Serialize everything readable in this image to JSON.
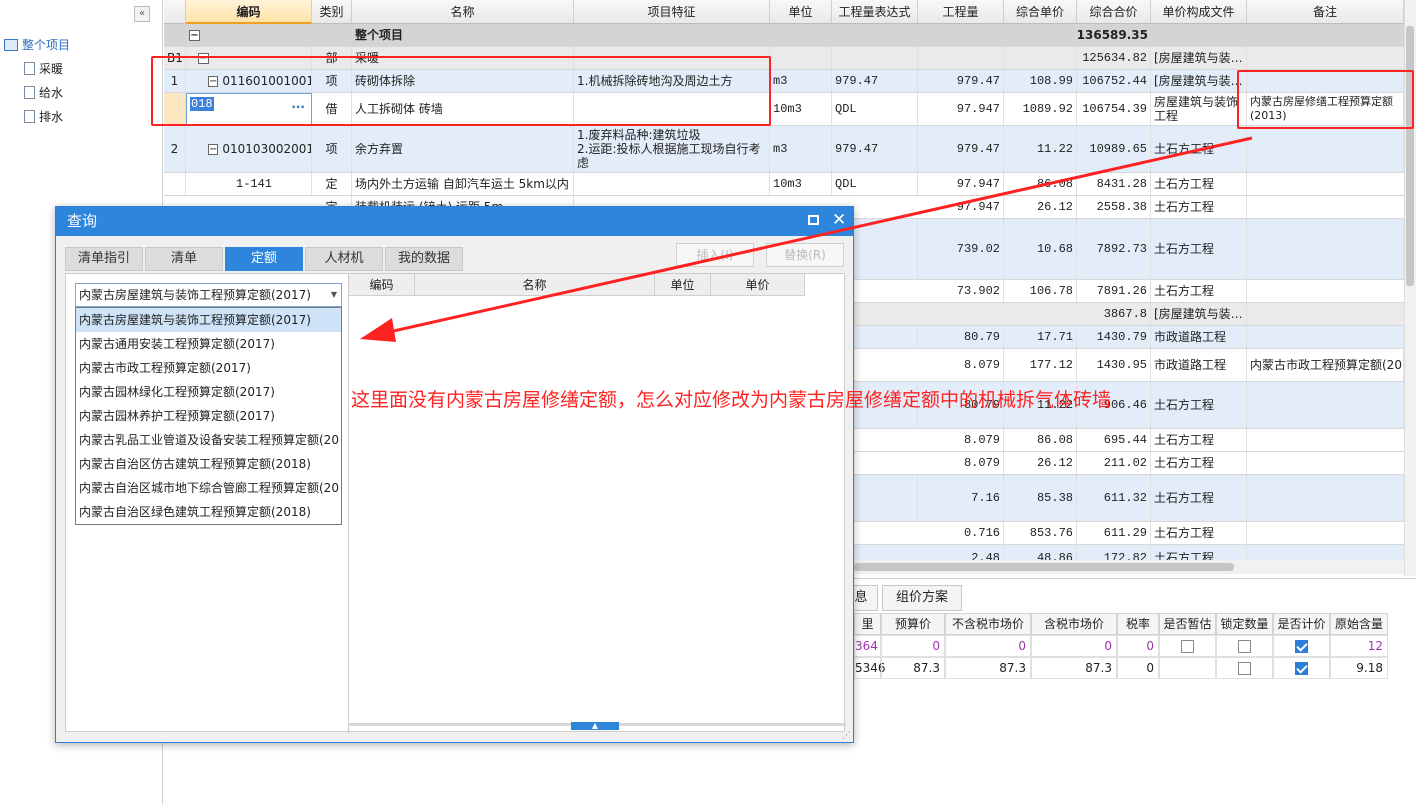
{
  "tree": {
    "collapse": "«",
    "root": "整个项目",
    "children": [
      "采暖",
      "给水",
      "排水"
    ]
  },
  "grid": {
    "headers": [
      "编码",
      "类别",
      "名称",
      "项目特征",
      "单位",
      "工程量表达式",
      "工程量",
      "综合单价",
      "综合合价",
      "单价构成文件",
      "备注"
    ],
    "rows": {
      "total": {
        "name": "整个项目",
        "total": "136589.35"
      },
      "b1": {
        "seq": "B1",
        "type": "部",
        "name": "采暖",
        "total": "125634.82",
        "file": "[房屋建筑与装…"
      },
      "r1": {
        "seq": "1",
        "code": "011601001001",
        "type": "项",
        "name": "砖砌体拆除",
        "feature": "1.机械拆除砖地沟及周边土方",
        "unit": "m3",
        "expr": "979.47",
        "qty": "979.47",
        "price": "108.99",
        "total": "106752.44",
        "file": "[房屋建筑与装…"
      },
      "r1s": {
        "code": "018",
        "type": "借",
        "name": "人工拆砌体 砖墙",
        "unit": "10m3",
        "expr": "QDL",
        "qty": "97.947",
        "price": "1089.92",
        "total": "106754.39",
        "file": "房屋建筑与装饰工程",
        "note": "内蒙古房屋修缮工程预算定额(2013)"
      },
      "r2": {
        "seq": "2",
        "code": "010103002001",
        "type": "项",
        "name": "余方弃置",
        "feature": "1.废弃料品种:建筑垃圾\n2.运距:投标人根据施工现场自行考虑",
        "unit": "m3",
        "expr": "979.47",
        "qty": "979.47",
        "price": "11.22",
        "total": "10989.65",
        "file": "土石方工程"
      },
      "r2a": {
        "code": "1-141",
        "type": "定",
        "name": "场内外土方运输 自卸汽车运土 5km以内",
        "unit": "10m3",
        "expr": "QDL",
        "qty": "97.947",
        "price": "86.08",
        "total": "8431.28",
        "file": "土石方工程"
      },
      "r2b": {
        "type": "定",
        "name": "装载机装运 (铲土) 运距 5m",
        "qty": "97.947",
        "price": "26.12",
        "total": "2558.38",
        "file": "土石方工程"
      },
      "r3": {
        "expr": "02",
        "qty": "739.02",
        "price": "10.68",
        "total": "7892.73",
        "file": "土石方工程"
      },
      "r3a": {
        "qty": "73.902",
        "price": "106.78",
        "total": "7891.26",
        "file": "土石方工程"
      },
      "b2": {
        "total": "3867.8",
        "file": "[房屋建筑与装…"
      },
      "r4": {
        "expr": "79",
        "qty": "80.79",
        "price": "17.71",
        "total": "1430.79",
        "file": "市政道路工程"
      },
      "r4a": {
        "qty": "8.079",
        "price": "177.12",
        "total": "1430.95",
        "file": "市政道路工程",
        "note": "内蒙古市政工程预算定额(201"
      },
      "r5": {
        "expr": "79",
        "qty": "80.79",
        "price": "11.22",
        "total": "906.46",
        "file": "土石方工程"
      },
      "r5a": {
        "qty": "8.079",
        "price": "86.08",
        "total": "695.44",
        "file": "土石方工程"
      },
      "r5b": {
        "qty": "8.079",
        "price": "26.12",
        "total": "211.02",
        "file": "土石方工程"
      },
      "r6": {
        "expr": "6",
        "qty": "7.16",
        "price": "85.38",
        "total": "611.32",
        "file": "土石方工程"
      },
      "r6a": {
        "qty": "0.716",
        "price": "853.76",
        "total": "611.29",
        "file": "土石方工程"
      },
      "r6b": {
        "qty": "2.48",
        "price": "48.86",
        "total": "172.82",
        "file": "土石方工程"
      }
    }
  },
  "bottom": {
    "tabs": [
      "息",
      "组价方案"
    ],
    "headers": [
      "里",
      "预算价",
      "不含税市场价",
      "含税市场价",
      "税率",
      "是否暂估",
      "锁定数量",
      "是否计价",
      "原始含量"
    ],
    "rows": [
      {
        "c0": "364",
        "budget": "0",
        "market_ex": "0",
        "market_in": "0",
        "tax": "0",
        "estimate": false,
        "lock": false,
        "priced": true,
        "orig": "12"
      },
      {
        "c0": "5346",
        "budget": "87.3",
        "market_ex": "87.3",
        "market_in": "87.3",
        "tax": "0",
        "estimate": false,
        "lock": false,
        "priced": true,
        "orig": "9.18"
      }
    ]
  },
  "dialog": {
    "title": "查询",
    "tabs": [
      "清单指引",
      "清单",
      "定额",
      "人材机",
      "我的数据"
    ],
    "active_tab": "定额",
    "insert_btn": "插入(I)",
    "replace_btn": "替换(R)",
    "combo_value": "内蒙古房屋建筑与装饰工程预算定额(2017)",
    "options": [
      "内蒙古房屋建筑与装饰工程预算定额(2017)",
      "内蒙古通用安装工程预算定额(2017)",
      "内蒙古市政工程预算定额(2017)",
      "内蒙古园林绿化工程预算定额(2017)",
      "内蒙古园林养护工程预算定额(2017)",
      "内蒙古乳品工业管道及设备安装工程预算定额(20",
      "内蒙古自治区仿古建筑工程预算定额(2018)",
      "内蒙古自治区城市地下综合管廊工程预算定额(20",
      "内蒙古自治区绿色建筑工程预算定额(2018)"
    ],
    "result_headers": [
      "编码",
      "名称",
      "单位",
      "单价"
    ]
  },
  "annotation": {
    "text": "这里面没有内蒙古房屋修缮定额，怎么对应修改为内蒙古房屋修缮定额中的机械拆气体砖墙",
    "color": "#ff2222"
  },
  "colors": {
    "accent": "#2d86dc",
    "row_alt": "#e3edf9",
    "section": "#d4d4d4"
  }
}
